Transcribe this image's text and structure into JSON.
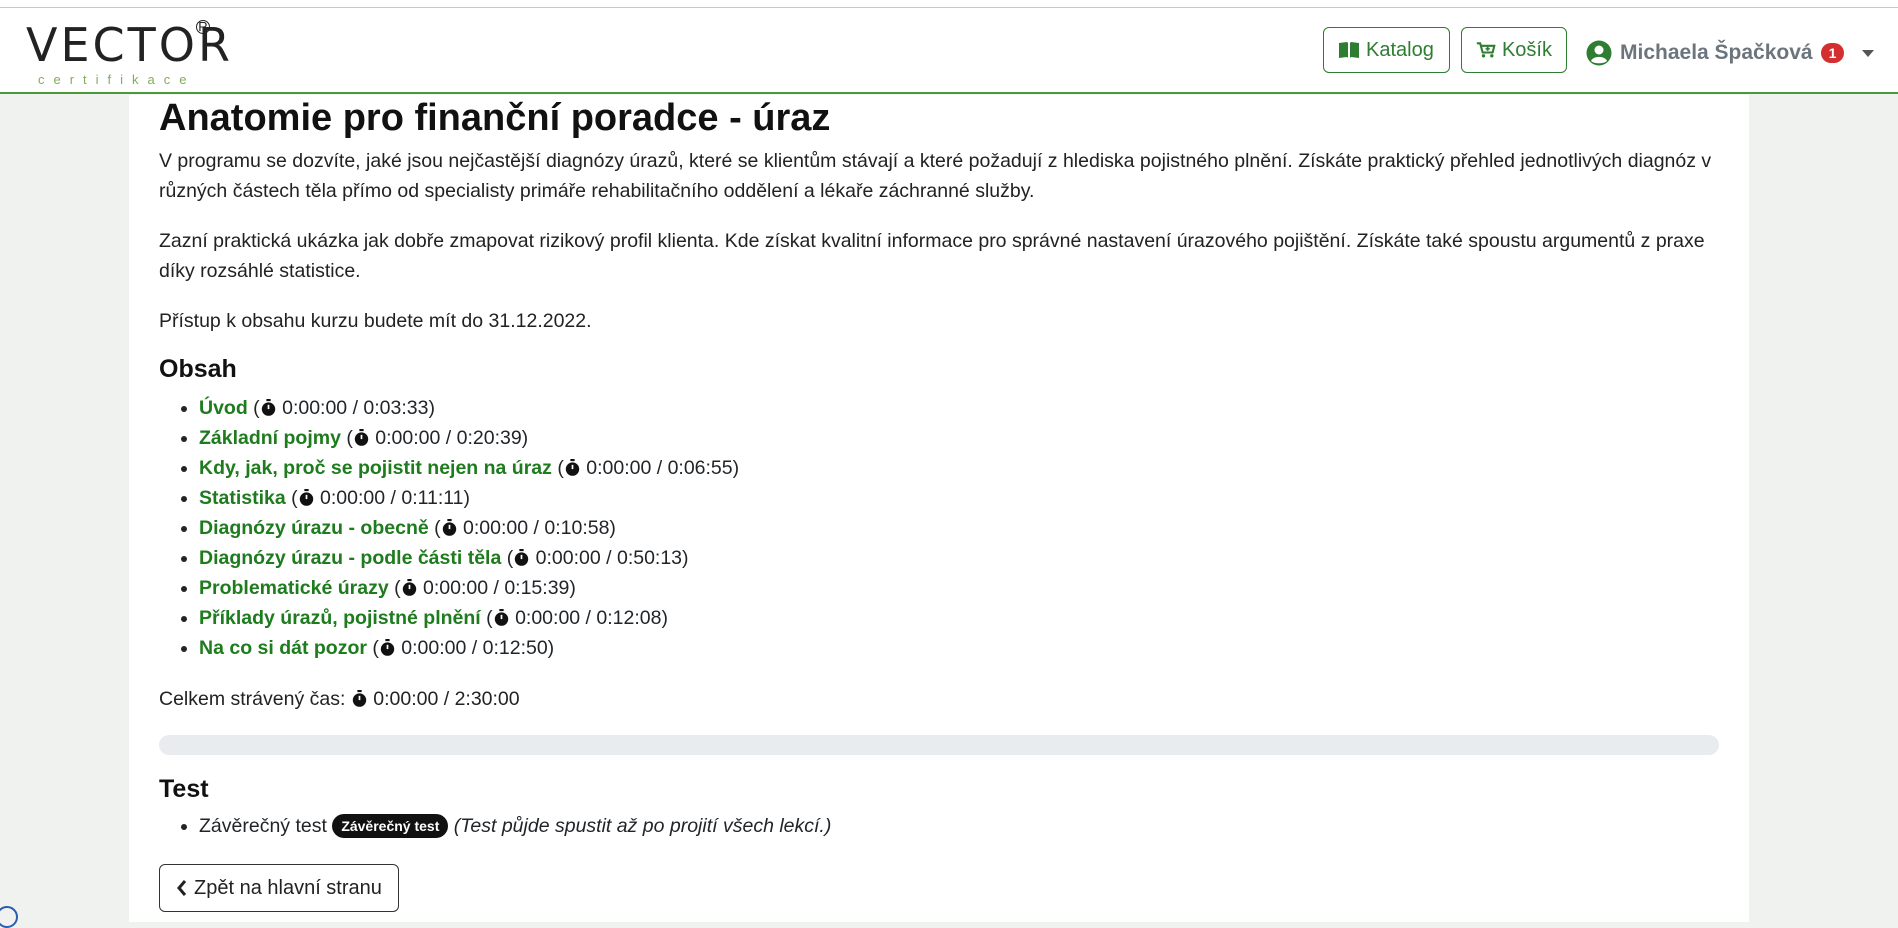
{
  "brand": {
    "logo_text": "VECTOR",
    "logo_subtext": "certifikace",
    "registered": "R"
  },
  "nav": {
    "catalog_label": "Katalog",
    "cart_label": "Košík",
    "user_name": "Michaela Špačková",
    "notification_count": "1"
  },
  "course": {
    "title": "Anatomie pro finanční poradce - úraz",
    "paragraphs": [
      "V programu se dozvíte, jaké jsou nejčastější diagnózy úrazů, které se klientům stávají a které požadují z hlediska pojistného plnění. Získáte praktický přehled jednotlivých diagnóz v různých částech těla přímo od specialisty primáře rehabilitačního oddělení a lékaře záchranné služby.",
      "Zazní praktická ukázka jak dobře zmapovat rizikový profil klienta. Kde získat kvalitní informace pro správné nastavení úrazového pojištění. Získáte také spoustu argumentů z praxe díky rozsáhlé statistice.",
      "Přístup k obsahu kurzu budete mít do 31.12.2022."
    ]
  },
  "contents": {
    "heading": "Obsah",
    "lessons": [
      {
        "title": "Úvod",
        "time": "0:00:00 / 0:03:33"
      },
      {
        "title": "Základní pojmy",
        "time": "0:00:00 / 0:20:39"
      },
      {
        "title": "Kdy, jak, proč se pojistit nejen na úraz",
        "time": "0:00:00 / 0:06:55"
      },
      {
        "title": "Statistika",
        "time": "0:00:00 / 0:11:11"
      },
      {
        "title": "Diagnózy úrazu - obecně",
        "time": "0:00:00 / 0:10:58"
      },
      {
        "title": "Diagnózy úrazu - podle části těla",
        "time": "0:00:00 / 0:50:13"
      },
      {
        "title": "Problematické úrazy",
        "time": "0:00:00 / 0:15:39"
      },
      {
        "title": "Příklady úrazů, pojistné plnění",
        "time": "0:00:00 / 0:12:08"
      },
      {
        "title": "Na co si dát pozor",
        "time": "0:00:00 / 0:12:50"
      }
    ],
    "total_label": "Celkem strávený čas:",
    "total_time": "0:00:00 / 2:30:00",
    "progress_fraction": 0
  },
  "test": {
    "heading": "Test",
    "item_label": "Závěrečný test",
    "badge": "Závěrečný test",
    "note": "(Test půjde spustit až po projití všech lekcí.)"
  },
  "back_button_label": "Zpět na hlavní stranu",
  "colors": {
    "accent_green": "#2e7d32",
    "link_green": "#1e7b1e",
    "badge_red": "#d32f2f",
    "progress_track": "#e9ecef"
  }
}
